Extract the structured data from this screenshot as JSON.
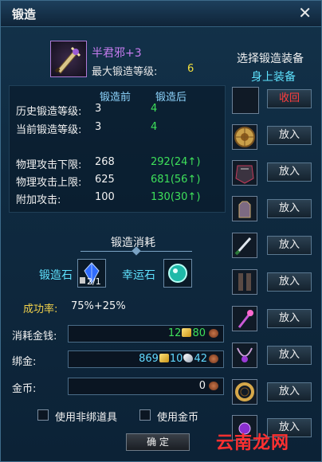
{
  "window": {
    "title": "锻造"
  },
  "item": {
    "name": "半君邪+3",
    "max_level_label": "最大锻造等级:",
    "max_level_value": "6"
  },
  "stats": {
    "col_before": "锻造前",
    "col_after": "锻造后",
    "rows": [
      {
        "label": "历史锻造等级:",
        "before": "3",
        "after": "4"
      },
      {
        "label": "当前锻造等级:",
        "before": "3",
        "after": "4"
      },
      {
        "label": "物理攻击下限:",
        "before": "268",
        "after": "292(24↑)"
      },
      {
        "label": "物理攻击上限:",
        "before": "625",
        "after": "681(56↑)"
      },
      {
        "label": "附加攻击:",
        "before": "100",
        "after": "130(30↑)"
      }
    ]
  },
  "cost": {
    "title": "锻造消耗",
    "forge_stone_label": "锻造石",
    "forge_stone_qty": "2/1",
    "luck_stone_label": "幸运石",
    "success_label": "成功率:",
    "success_value": "75%+25%",
    "money_label": "消耗金钱:",
    "money_gold": "12",
    "money_silver": "80",
    "bound_label": "绑金:",
    "bound_copper": "869",
    "bound_gold": "10",
    "bound_silver": "42",
    "coin_label": "金币:",
    "coin_value": "0"
  },
  "options": {
    "use_unbound": "使用非绑道具",
    "use_coin": "使用金币"
  },
  "confirm_label": "确 定",
  "right_panel": {
    "title": "选择锻造装备",
    "subtitle": "身上装备",
    "retract_label": "收回",
    "put_label": "放入"
  },
  "watermark": "云南龙网"
}
